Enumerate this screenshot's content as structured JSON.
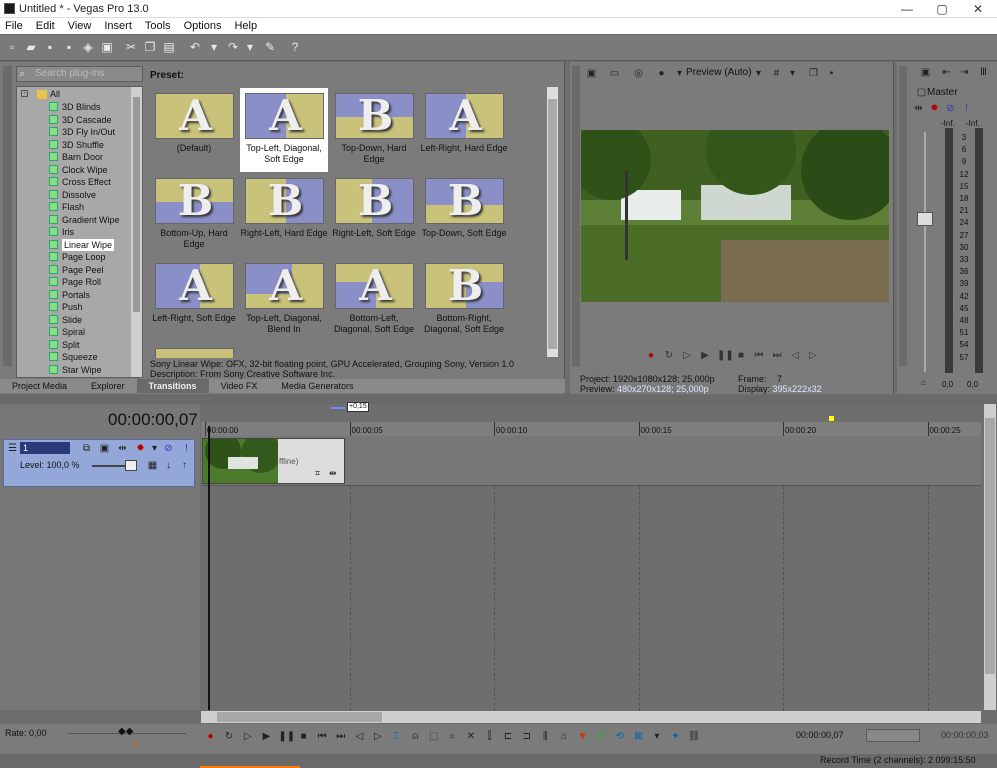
{
  "window": {
    "title": "Untitled * - Vegas Pro 13.0",
    "minimize": "—",
    "maximize": "▢",
    "close": "✕"
  },
  "menu": [
    "File",
    "Edit",
    "View",
    "Insert",
    "Tools",
    "Options",
    "Help"
  ],
  "plugins": {
    "search_placeholder": "Search plug-ins",
    "root": "All",
    "items": [
      "3D Blinds",
      "3D Cascade",
      "3D Fly In/Out",
      "3D Shuffle",
      "Barn Door",
      "Clock Wipe",
      "Cross Effect",
      "Dissolve",
      "Flash",
      "Gradient Wipe",
      "Iris",
      "Linear Wipe",
      "Page Loop",
      "Page Peel",
      "Page Roll",
      "Portals",
      "Push",
      "Slide",
      "Spiral",
      "Split",
      "Squeeze",
      "Star Wipe"
    ],
    "selected": "Linear Wipe"
  },
  "presets": {
    "label": "Preset:",
    "items": [
      {
        "label": "(Default)",
        "letter": "A"
      },
      {
        "label": "Top-Left, Diagonal, Soft Edge",
        "letter": "A"
      },
      {
        "label": "Top-Down, Hard Edge",
        "letter": "B"
      },
      {
        "label": "Left-Right, Hard Edge",
        "letter": "A"
      },
      {
        "label": "Bottom-Up, Hard Edge",
        "letter": "B"
      },
      {
        "label": "Right-Left, Hard Edge",
        "letter": "B"
      },
      {
        "label": "Right-Left, Soft Edge",
        "letter": "B"
      },
      {
        "label": "Top-Down, Soft Edge",
        "letter": "B"
      },
      {
        "label": "Left-Right, Soft Edge",
        "letter": "A"
      },
      {
        "label": "Top-Left, Diagonal, Blend In",
        "letter": "A"
      },
      {
        "label": "Bottom-Left, Diagonal, Soft Edge",
        "letter": "A"
      },
      {
        "label": "Bottom-Right, Diagonal, Soft Edge",
        "letter": "B"
      }
    ],
    "selected_index": 1,
    "description_line1": "Sony Linear Wipe: OFX, 32-bit floating point, GPU Accelerated, Grouping Sony, Version 1.0",
    "description_line2": "Description: From Sony Creative Software Inc."
  },
  "window_tabs": [
    "Project Media",
    "Explorer",
    "Transitions",
    "Video FX",
    "Media Generators"
  ],
  "active_tab": "Transitions",
  "preview": {
    "mode": "Preview (Auto)",
    "project_label": "Project:",
    "project_value": "1920x1080x128; 25,000p",
    "preview_label": "Preview:",
    "preview_value": "480x270x128; 25,000p",
    "frame_label": "Frame:",
    "frame_value": "7",
    "display_label": "Display:",
    "display_value": "395x222x32"
  },
  "master": {
    "label": "Master",
    "inf_left": "-Inf.",
    "inf_right": "-Inf.",
    "scale": [
      "3",
      "6",
      "9",
      "12",
      "15",
      "18",
      "21",
      "24",
      "27",
      "30",
      "33",
      "36",
      "39",
      "42",
      "45",
      "48",
      "51",
      "54",
      "57"
    ],
    "fader_left": "0,0",
    "fader_right": "0,0"
  },
  "timeline": {
    "timecode": "00:00:00,07",
    "marker_label": "+0,15",
    "ruler": [
      "00:00:00",
      "00:00:05",
      "00:00:10",
      "00:00:15",
      "00:00:20",
      "00:00:25"
    ],
    "track_level": "Level: 100,0 %",
    "track_number": "1",
    "clip_text": "ffline)"
  },
  "bottom": {
    "rate": "Rate: 0,00",
    "cursor_time": "00:00:00,07",
    "end_time": "00:00:00,03",
    "record_time": "Record Time (2 channels): 2 099:15:50"
  }
}
